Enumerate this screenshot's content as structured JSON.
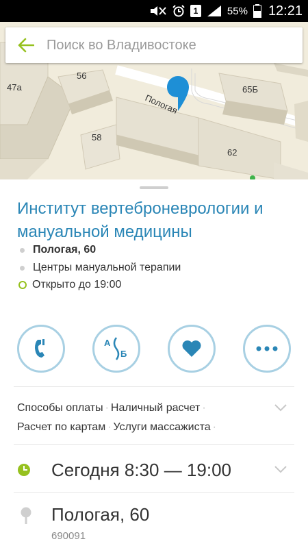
{
  "status_bar": {
    "battery": "55%",
    "sim": "1",
    "time": "12:21"
  },
  "map": {
    "labels": {
      "b47a": "47а",
      "b56": "56",
      "b58": "58",
      "b65b": "65Б",
      "b62": "62",
      "street": "Пологая"
    }
  },
  "search": {
    "placeholder": "Поиск во Владивостоке"
  },
  "place": {
    "title": "Институт вертеброневрологии и мануальной медицины",
    "address": "Пологая, 60",
    "category": "Центры мануальной терапии",
    "open_status": "Открыто до 19:00"
  },
  "actions": [
    {
      "icon": "phone-icon"
    },
    {
      "icon": "route-icon"
    },
    {
      "icon": "heart-icon"
    },
    {
      "icon": "more-icon"
    }
  ],
  "payments": {
    "items": [
      "Способы оплаты",
      "Наличный расчет",
      "Расчет по картам",
      "Услуги массажиста"
    ]
  },
  "hours": {
    "text": "Сегодня 8:30 — 19:00"
  },
  "address_block": {
    "street": "Пологая, 60",
    "zip": "690091"
  },
  "colors": {
    "accent": "#2a86b6",
    "green": "#96c11f",
    "ring": "#a8d0e3"
  }
}
